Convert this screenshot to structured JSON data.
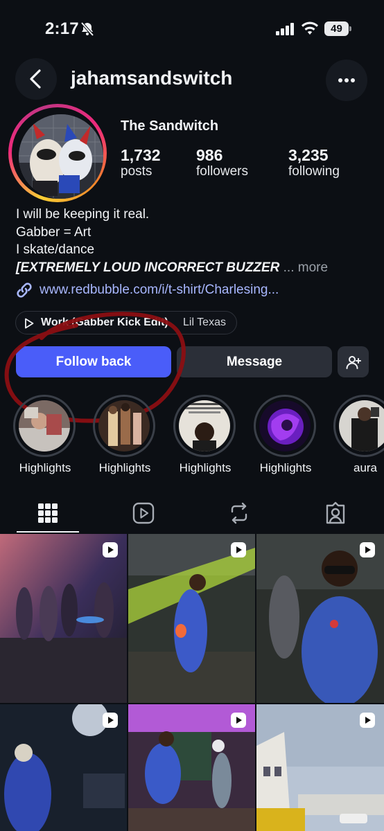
{
  "status_bar": {
    "time": "2:17",
    "battery": "49"
  },
  "header": {
    "username": "jahamsandswitch"
  },
  "profile": {
    "display_name": "The Sandwitch",
    "stats": [
      {
        "value": "1,732",
        "label": "posts"
      },
      {
        "value": "986",
        "label": "followers"
      },
      {
        "value": "3,235",
        "label": "following"
      }
    ]
  },
  "bio": {
    "lines": [
      "I will be keeping it real.",
      "Gabber = Art",
      "I skate/dance"
    ],
    "last_line": "[EXTREMELY LOUD INCORRECT BUZZER",
    "ellipsis": " ...",
    "more": " more",
    "link": "www.redbubble.com/i/t-shirt/Charlesing..."
  },
  "music": {
    "title": "Work (Gabber Kick Edit)",
    "artist": "Lil Texas"
  },
  "actions": {
    "follow_back": "Follow back",
    "message": "Message"
  },
  "highlights": [
    {
      "label": "Highlights"
    },
    {
      "label": "Highlights"
    },
    {
      "label": "Highlights"
    },
    {
      "label": "Highlights"
    },
    {
      "label": "aura"
    }
  ],
  "tabs": [
    {
      "icon": "grid-icon",
      "active": true
    },
    {
      "icon": "reels-icon",
      "active": false
    },
    {
      "icon": "reposts-icon",
      "active": false
    },
    {
      "icon": "tagged-icon",
      "active": false
    }
  ],
  "posts_count_visible": 6,
  "colors": {
    "accent": "#4a5df9",
    "annotation": "#8b0f12",
    "link": "#a8b7ff"
  }
}
